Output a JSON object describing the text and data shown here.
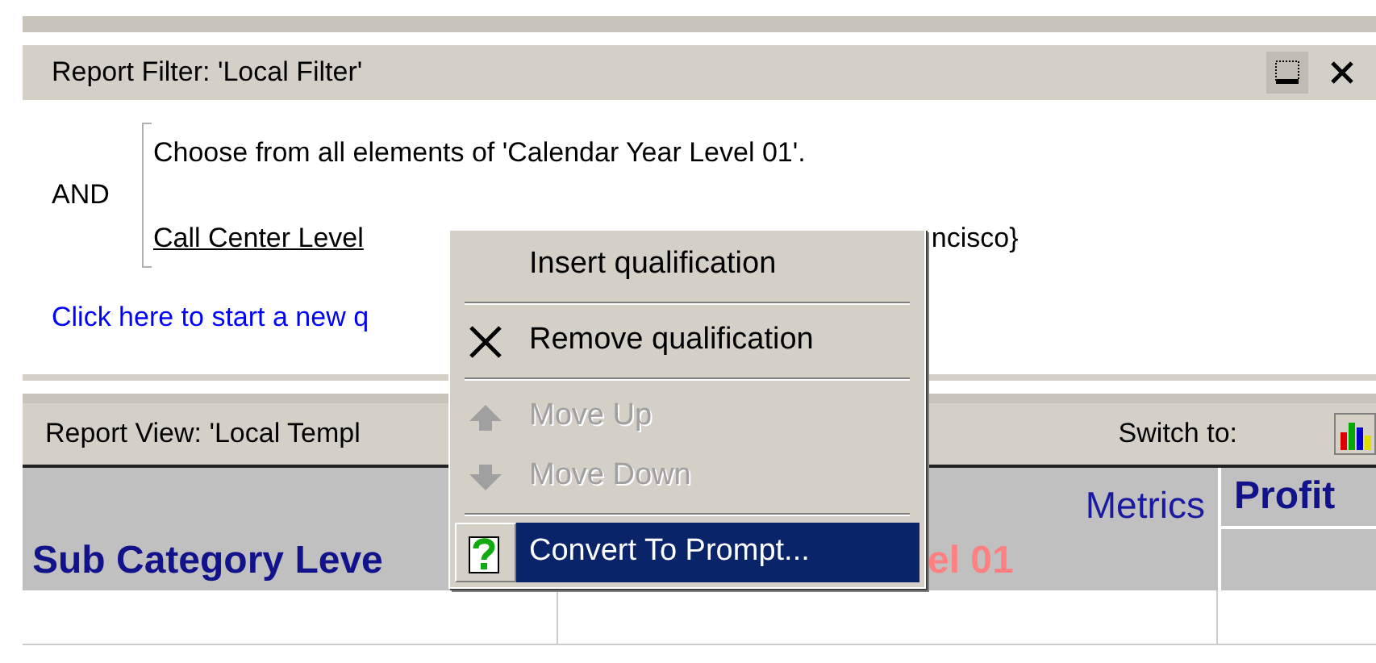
{
  "filter_panel": {
    "title": "Report Filter: 'Local Filter'",
    "operator": "AND",
    "qualifications": [
      {
        "kind": "plain",
        "text": "Choose from all elements of 'Calendar Year Level 01'."
      },
      {
        "kind": "link",
        "text": "Call Center Level",
        "tail": "ncisco}"
      }
    ],
    "new_link": "Click here to start a new q"
  },
  "view_panel": {
    "title": "Report View: 'Local Templ",
    "switch_label": "Switch to:"
  },
  "grid": {
    "row_header": "Sub Category Leve",
    "row_header_tail": "el 01",
    "metrics_label": "Metrics",
    "column_header": "Profit"
  },
  "context_menu": [
    {
      "kind": "plain",
      "label": "Insert qualification",
      "disabled": false,
      "selected": false
    },
    {
      "kind": "separator"
    },
    {
      "kind": "remove",
      "label": "Remove qualification",
      "disabled": false,
      "selected": false
    },
    {
      "kind": "separator"
    },
    {
      "kind": "up",
      "label": "Move Up",
      "disabled": true,
      "selected": false
    },
    {
      "kind": "down",
      "label": "Move Down",
      "disabled": true,
      "selected": false
    },
    {
      "kind": "separator"
    },
    {
      "kind": "prompt",
      "label": "Convert To Prompt...",
      "disabled": false,
      "selected": true
    }
  ]
}
